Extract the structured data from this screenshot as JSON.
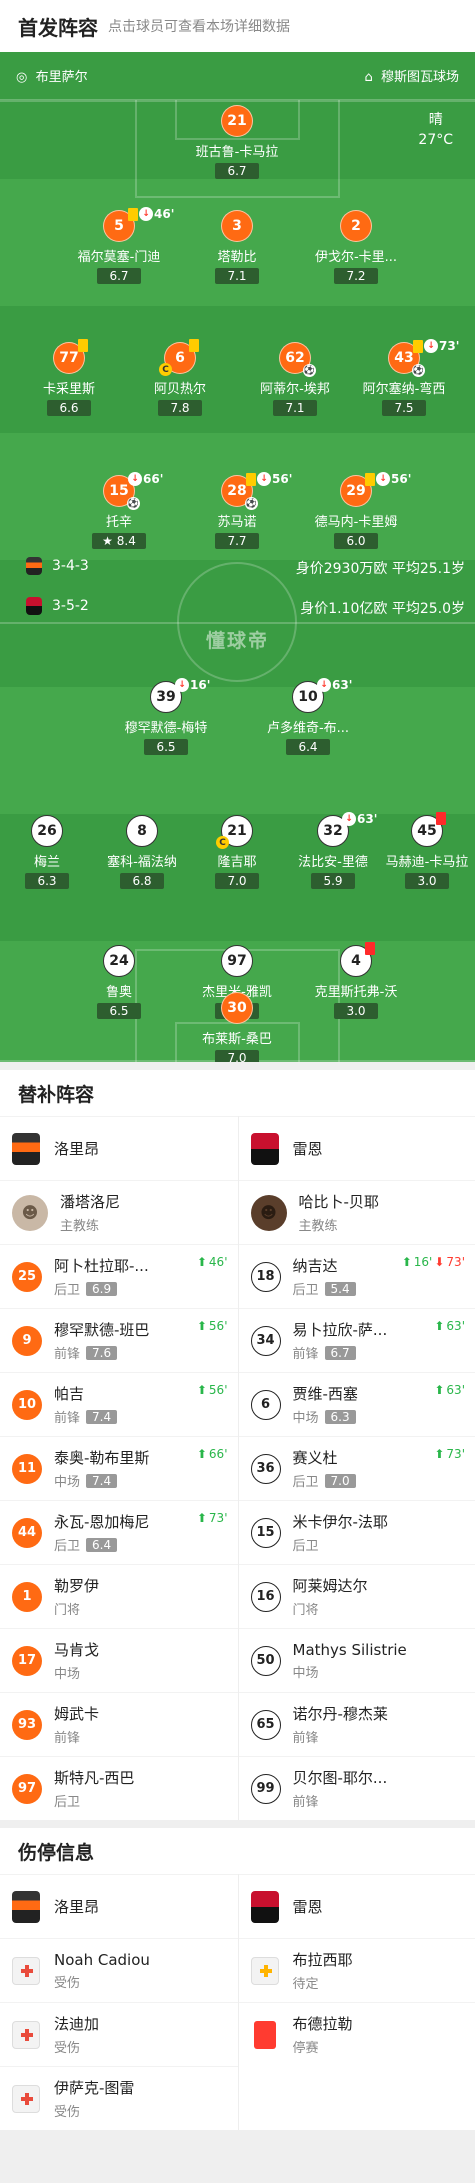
{
  "header": {
    "title": "首发阵容",
    "hint": "点击球员可查看本场详细数据"
  },
  "pitch": {
    "home_team": "布里萨尔",
    "away_team": "穆斯图瓦球场",
    "weather": "晴",
    "temp": "27°C",
    "watermark": "懂球帝",
    "home_formation": "3-4-3",
    "away_formation": "3-5-2",
    "home_value": "身价2930万欧 平均25.1岁",
    "away_value": "身价1.10亿欧 平均25.0岁"
  },
  "players": [
    {
      "num": "21",
      "name": "班古鲁-卡马拉",
      "rating": "6.7"
    },
    {
      "num": "5",
      "name": "福尔莫塞-门迪",
      "rating": "6.7",
      "min": "46'"
    },
    {
      "num": "3",
      "name": "塔勒比",
      "rating": "7.1"
    },
    {
      "num": "2",
      "name": "伊戈尔-卡里...",
      "rating": "7.2"
    },
    {
      "num": "77",
      "name": "卡采里斯",
      "rating": "6.6"
    },
    {
      "num": "6",
      "name": "阿贝热尔",
      "rating": "7.8"
    },
    {
      "num": "62",
      "name": "阿蒂尔-埃邦",
      "rating": "7.1"
    },
    {
      "num": "43",
      "name": "阿尔塞纳-弯西",
      "rating": "7.5",
      "min": "73'"
    },
    {
      "num": "15",
      "name": "托辛",
      "rating": "8.4",
      "min": "66'"
    },
    {
      "num": "28",
      "name": "苏马诺",
      "rating": "7.7",
      "min": "56'"
    },
    {
      "num": "29",
      "name": "德马内-卡里姆",
      "rating": "6.0",
      "min": "56'"
    },
    {
      "num": "39",
      "name": "穆罕默德-梅特",
      "rating": "6.5",
      "min": "16'"
    },
    {
      "num": "10",
      "name": "卢多维奇-布...",
      "rating": "6.4",
      "min": "63'"
    },
    {
      "num": "26",
      "name": "梅兰",
      "rating": "6.3"
    },
    {
      "num": "8",
      "name": "塞科-福法纳",
      "rating": "6.8"
    },
    {
      "num": "21",
      "name": "隆吉耶",
      "rating": "7.0"
    },
    {
      "num": "32",
      "name": "法比安-里德",
      "rating": "5.9",
      "min": "63'"
    },
    {
      "num": "45",
      "name": "马赫迪-卡马拉",
      "rating": "3.0"
    },
    {
      "num": "24",
      "name": "鲁奥",
      "rating": "6.5"
    },
    {
      "num": "97",
      "name": "杰里米-雅凯",
      "rating": "6.1"
    },
    {
      "num": "4",
      "name": "克里斯托弗-沃",
      "rating": "3.0"
    },
    {
      "num": "30",
      "name": "布莱斯-桑巴",
      "rating": "7.0"
    }
  ],
  "subs": {
    "title": "替补阵容",
    "home_team": "洛里昂",
    "away_team": "雷恩",
    "home_coach": {
      "name": "潘塔洛尼",
      "role": "主教练"
    },
    "away_coach": {
      "name": "哈比卜-贝耶",
      "role": "主教练"
    },
    "home": [
      {
        "num": "25",
        "name": "阿卜杜拉耶-...",
        "pos": "后卫",
        "rating": "6.9",
        "ev": "46'"
      },
      {
        "num": "9",
        "name": "穆罕默德-班巴",
        "pos": "前锋",
        "rating": "7.6",
        "ev": "56'"
      },
      {
        "num": "10",
        "name": "帕吉",
        "pos": "前锋",
        "rating": "7.4",
        "ev": "56'"
      },
      {
        "num": "11",
        "name": "泰奥-勒布里斯",
        "pos": "中场",
        "rating": "7.4",
        "ev": "66'"
      },
      {
        "num": "44",
        "name": "永瓦-恩加梅尼",
        "pos": "后卫",
        "rating": "6.4",
        "ev": "73'"
      },
      {
        "num": "1",
        "name": "勒罗伊",
        "pos": "门将"
      },
      {
        "num": "17",
        "name": "马肯戈",
        "pos": "中场"
      },
      {
        "num": "93",
        "name": "姆武卡",
        "pos": "前锋"
      },
      {
        "num": "97",
        "name": "斯特凡-西巴",
        "pos": "后卫"
      }
    ],
    "away": [
      {
        "num": "18",
        "name": "纳吉达",
        "pos": "后卫",
        "rating": "5.4",
        "ev": "16'",
        "ev2": "73'"
      },
      {
        "num": "34",
        "name": "易卜拉欣-萨...",
        "pos": "前锋",
        "rating": "6.7",
        "ev": "63'"
      },
      {
        "num": "6",
        "name": "贾维-西塞",
        "pos": "中场",
        "rating": "6.3",
        "ev": "63'"
      },
      {
        "num": "36",
        "name": "赛义杜",
        "pos": "后卫",
        "rating": "7.0",
        "ev": "73'"
      },
      {
        "num": "15",
        "name": "米卡伊尔-法耶",
        "pos": "后卫"
      },
      {
        "num": "16",
        "name": "阿莱姆达尔",
        "pos": "门将"
      },
      {
        "num": "50",
        "name": "Mathys Silistrie",
        "pos": "中场"
      },
      {
        "num": "65",
        "name": "诺尔丹-穆杰莱",
        "pos": "前锋"
      },
      {
        "num": "99",
        "name": "贝尔图-耶尔...",
        "pos": "前锋"
      }
    ]
  },
  "injuries": {
    "title": "伤停信息",
    "home": [
      {
        "name": "Noah Cadiou",
        "status": "受伤"
      },
      {
        "name": "法迪加",
        "status": "受伤"
      },
      {
        "name": "伊萨克-图雷",
        "status": "受伤"
      }
    ],
    "away": [
      {
        "name": "布拉西耶",
        "status": "待定"
      },
      {
        "name": "布德拉勒",
        "status": "停赛"
      }
    ]
  }
}
